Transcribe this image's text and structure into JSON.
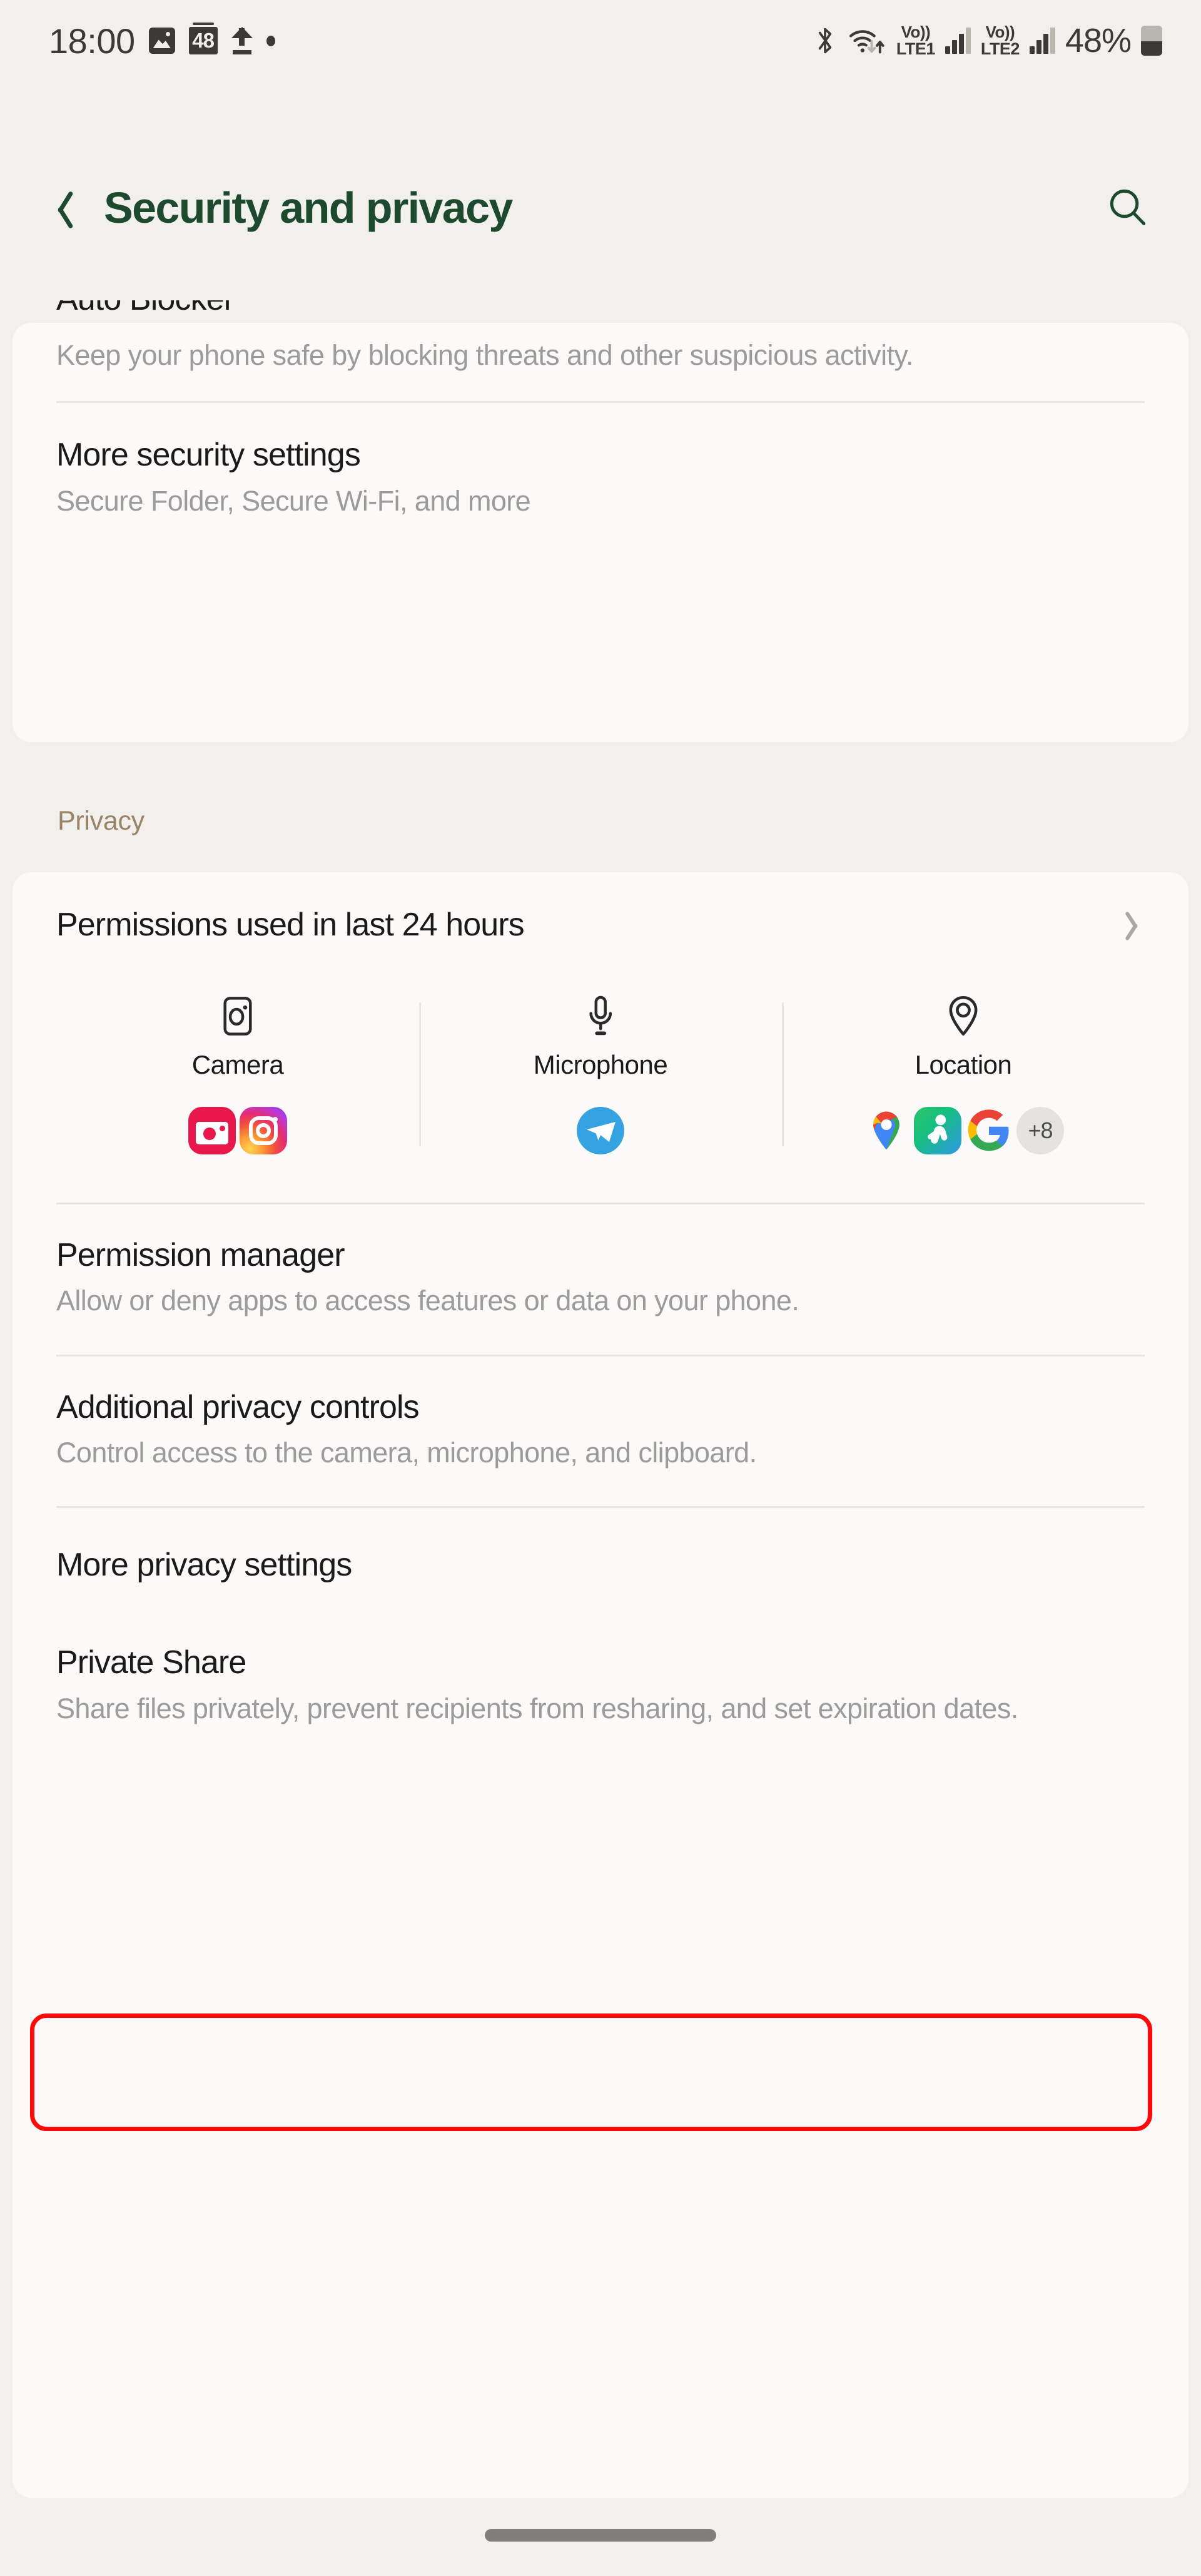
{
  "status_bar": {
    "time": "18:00",
    "icons_left": [
      "photo-icon",
      "badge-48-icon",
      "upload-icon",
      "dot-icon"
    ],
    "badge_count": "48",
    "icons_right": [
      "bluetooth-icon",
      "wifi-icon",
      "volte1-icon",
      "signal1-icon",
      "volte2-icon",
      "signal2-icon"
    ],
    "sim1_vo": "Vo))",
    "sim1_lte": "LTE1",
    "sim2_vo": "Vo))",
    "sim2_lte": "LTE2",
    "battery_percent": "48%",
    "battery_level": 48
  },
  "app_bar": {
    "back_icon": "chevron-left-icon",
    "title": "Security and privacy",
    "search_icon": "search-icon",
    "title_color": "#1d4a2f"
  },
  "security_card": {
    "auto_blocker": {
      "title": "Auto Blocker",
      "subtitle": "Keep your phone safe by blocking threats and other suspicious activity."
    },
    "more_security_settings": {
      "title": "More security settings",
      "subtitle": "Secure Folder, Secure Wi-Fi, and more"
    }
  },
  "privacy_section": {
    "label": "Privacy",
    "label_color": "#9a8468",
    "permissions_used": {
      "title": "Permissions used in last 24 hours",
      "chevron_icon": "chevron-right-icon",
      "columns": [
        {
          "label": "Camera",
          "icon": "camera-icon",
          "apps": [
            "camera-app-icon",
            "instagram-app-icon"
          ],
          "overflow": null
        },
        {
          "label": "Microphone",
          "icon": "microphone-icon",
          "apps": [
            "telegram-app-icon"
          ],
          "overflow": null
        },
        {
          "label": "Location",
          "icon": "location-pin-icon",
          "apps": [
            "google-maps-app-icon",
            "google-fit-app-icon",
            "google-app-icon"
          ],
          "overflow": "+8"
        }
      ]
    },
    "permission_manager": {
      "title": "Permission manager",
      "subtitle": "Allow or deny apps to access features or data on your phone."
    },
    "additional_privacy_controls": {
      "title": "Additional privacy controls",
      "subtitle": "Control access to the camera, microphone, and clipboard."
    },
    "more_privacy_settings": {
      "title": "More privacy settings",
      "highlighted": true,
      "highlight_color": "#ff0a0a"
    },
    "private_share": {
      "title": "Private Share",
      "subtitle": "Share files privately, prevent recipients from resharing, and set expiration dates."
    }
  },
  "nav_bar": {
    "gesture_handle": "home-gesture-pill"
  }
}
